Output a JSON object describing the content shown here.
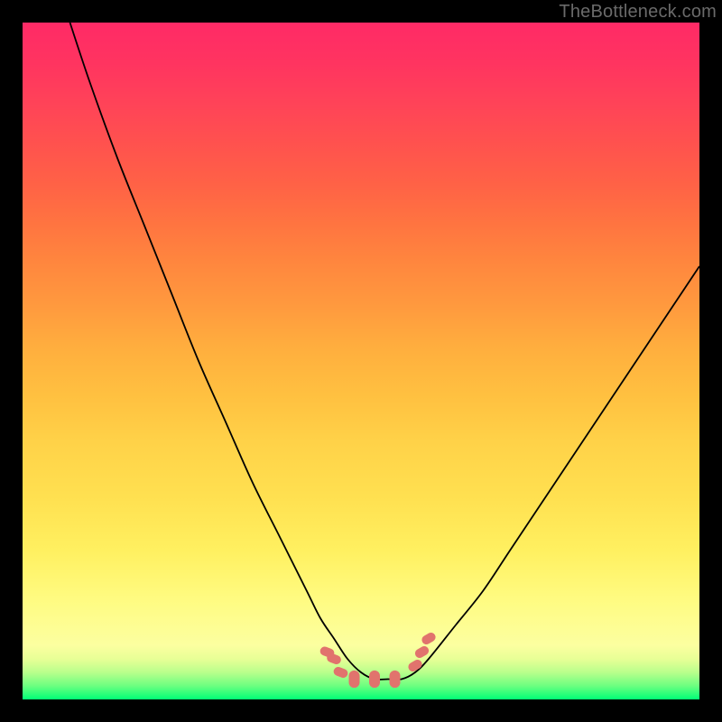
{
  "watermark": "TheBottleneck.com",
  "chart_data": {
    "type": "line",
    "title": "",
    "xlabel": "",
    "ylabel": "",
    "xlim": [
      0,
      100
    ],
    "ylim": [
      0,
      100
    ],
    "grid": false,
    "legend": false,
    "series": [
      {
        "name": "curve",
        "color": "#000000",
        "x": [
          7,
          10,
          14,
          18,
          22,
          26,
          30,
          34,
          38,
          42,
          44,
          46,
          48,
          50,
          52,
          54,
          56,
          58,
          60,
          64,
          68,
          72,
          76,
          80,
          84,
          88,
          92,
          96,
          100
        ],
        "y": [
          100,
          91,
          80,
          70,
          60,
          50,
          41,
          32,
          24,
          16,
          12,
          9,
          6,
          4,
          3,
          3,
          3,
          4,
          6,
          11,
          16,
          22,
          28,
          34,
          40,
          46,
          52,
          58,
          64
        ]
      },
      {
        "name": "markers",
        "color": "#e1736d",
        "type": "scatter",
        "points": [
          {
            "x": 45,
            "y": 7,
            "size": 5
          },
          {
            "x": 46,
            "y": 6,
            "size": 5
          },
          {
            "x": 47,
            "y": 4,
            "size": 5
          },
          {
            "x": 49,
            "y": 3,
            "size": 6
          },
          {
            "x": 52,
            "y": 3,
            "size": 6
          },
          {
            "x": 55,
            "y": 3,
            "size": 6
          },
          {
            "x": 58,
            "y": 5,
            "size": 5
          },
          {
            "x": 59,
            "y": 7,
            "size": 5
          },
          {
            "x": 60,
            "y": 9,
            "size": 5
          }
        ]
      }
    ]
  }
}
